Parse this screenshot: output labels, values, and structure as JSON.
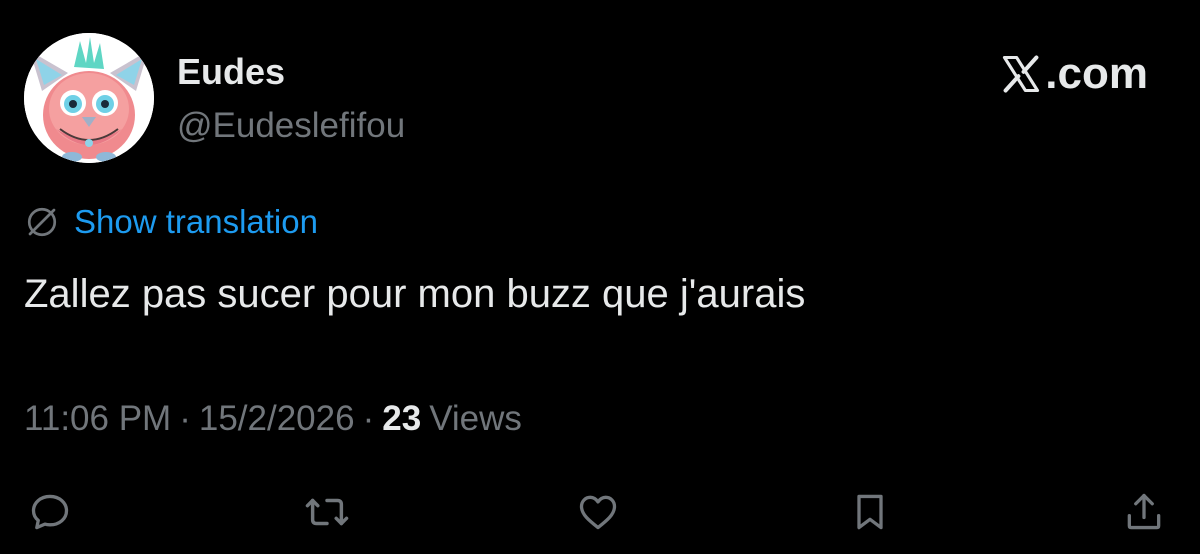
{
  "tweet": {
    "author": {
      "display_name": "Eudes",
      "handle": "@Eudeslefifou",
      "avatar_icon": "furby-avatar"
    },
    "brand": {
      "label": ".com",
      "icon": "x-logo-icon"
    },
    "translation": {
      "label": "Show translation",
      "icon": "globe-slash-icon"
    },
    "text": "Zallez pas sucer pour mon buzz que j'aurais",
    "meta": {
      "time": "11:06 PM",
      "separator": "·",
      "date": "15/2/2026",
      "views_count": "23",
      "views_label": "Views"
    },
    "actions": [
      {
        "name": "reply",
        "icon": "reply-icon"
      },
      {
        "name": "retweet",
        "icon": "retweet-icon"
      },
      {
        "name": "like",
        "icon": "heart-icon"
      },
      {
        "name": "bookmark",
        "icon": "bookmark-icon"
      },
      {
        "name": "share",
        "icon": "share-icon"
      }
    ]
  },
  "colors": {
    "background": "#000000",
    "primary_text": "#e7e9ea",
    "secondary_text": "#71767b",
    "link": "#1d9bf0"
  }
}
